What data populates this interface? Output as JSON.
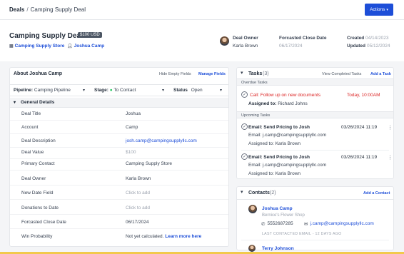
{
  "breadcrumb": {
    "root": "Deals",
    "separator": "/",
    "current": "Camping Supply Deal"
  },
  "actions_label": "Actions",
  "deal": {
    "title": "Camping Supply Deal",
    "amount_badge": "$100 USD",
    "account_link": "Camping Supply Store",
    "contact_link": "Joshua Camp"
  },
  "meta": {
    "owner_label": "Deal Owner",
    "owner_value": "Karla Brown",
    "close_label": "Forcasted Close Date",
    "close_value": "06/17/2024",
    "created_label": "Created",
    "created_value": "04/14/2023",
    "updated_label": "Updated",
    "updated_value": "05/12/2024"
  },
  "about": {
    "title": "About Joshua Camp",
    "hide_empty": "Hide Empty Fields",
    "manage_fields": "Manage Fields",
    "pipeline_label": "Pipeline:",
    "pipeline_value": "Camping Pipeline",
    "stage_label": "Stage:",
    "stage_value": "To Contact",
    "status_label": "Status",
    "status_value": "Open",
    "section_title": "General Details",
    "fields": [
      {
        "label": "Deal Title",
        "value": "Joshua"
      },
      {
        "label": "Account",
        "value": "Camp"
      },
      {
        "label": "Deal Description",
        "value": "josh.camp@campingsupplyllc.com"
      },
      {
        "label": "Deal Value",
        "value": "$100"
      },
      {
        "label": "Primary Contact",
        "value": "Camping Supply Store"
      },
      {
        "label": "Deal Owner",
        "value": "Karla Brown"
      },
      {
        "label": "New Date Field",
        "value": "Click to add"
      },
      {
        "label": "Donations to Date",
        "value": "Click to add"
      },
      {
        "label": "Forcasted Close Date",
        "value": "06/17/2024"
      },
      {
        "label": "Win Probability",
        "value": "Not yet calculated.",
        "link": "Learn more here"
      }
    ]
  },
  "tasks": {
    "title": "Tasks",
    "count": "(3)",
    "view_completed": "View Completed Tasks",
    "add_task": "Add a Task",
    "overdue_label": "Overdue Tasks",
    "upcoming_label": "Upcoming Tasks",
    "overdue": [
      {
        "title": "Call: Follow up on new documents",
        "date": "Today, 10:00AM",
        "assigned_label": "Assigned to:",
        "assigned": "Richard Johns"
      }
    ],
    "upcoming": [
      {
        "title": "Email: Send Pricing to Josh",
        "date": "03/26/2024 11:19",
        "email": "Email: j.camp@campingsupplyllc.com",
        "assigned_label": "Assigned to:",
        "assigned": "Karla Brown"
      },
      {
        "title": "Email: Send Pricing to Josh",
        "date": "03/26/2024 11:19",
        "email": "Email: j.camp@campingsupplyllc.com",
        "assigned_label": "Assigned to:",
        "assigned": "Karla Brown"
      }
    ]
  },
  "contacts": {
    "title": "Contacts",
    "count": "(2)",
    "add_contact": "Add a Contact",
    "items": [
      {
        "name": "Joshua Camp",
        "company": "Bernice's Flower Shop",
        "phone": "5552687285",
        "email": "j.camp@campingsupplyllc.com",
        "last_contacted": "LAST CONTACTED EMAIL - 12 DAYS AGO"
      },
      {
        "name": "Terry Johnson"
      }
    ]
  },
  "icons": {
    "actions_caret": "chevron-down-icon",
    "building": "building-icon",
    "person": "person-icon",
    "check": "check-icon",
    "phone": "phone-icon",
    "mail": "mail-icon",
    "kebab": "more-vertical-icon"
  },
  "colors": {
    "primary": "#1d4ed8",
    "overdue": "#dc2626",
    "stage_dot": "#22c55e",
    "badge": "#4b5563"
  }
}
